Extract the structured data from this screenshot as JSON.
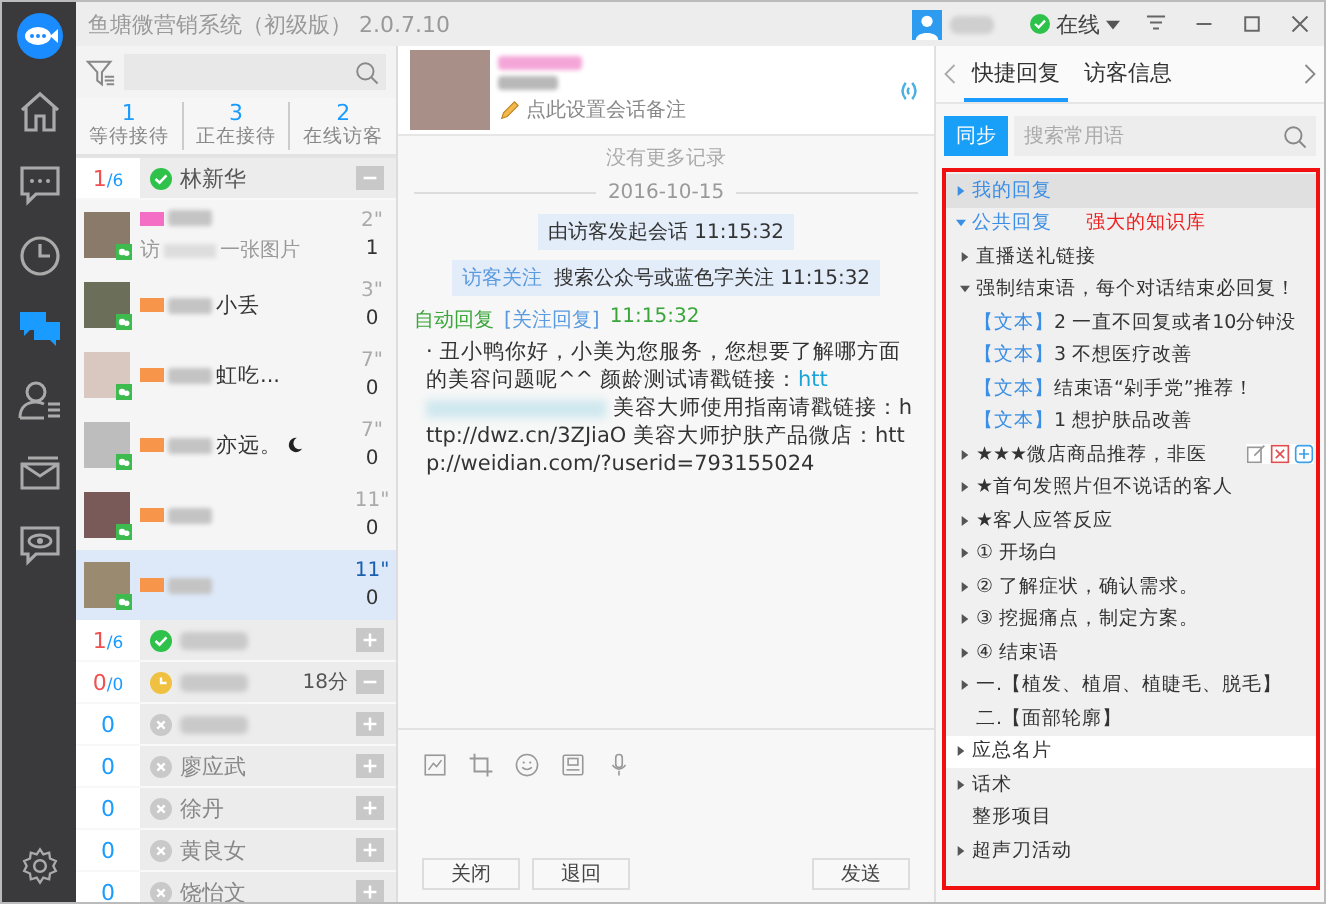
{
  "window": {
    "title": "鱼塘微营销系统（初级版） 2.0.7.10",
    "status": "在线"
  },
  "nav": [
    {
      "kind": "home",
      "selected": false
    },
    {
      "kind": "message",
      "selected": false
    },
    {
      "kind": "history",
      "selected": false
    },
    {
      "kind": "chat",
      "selected": true
    },
    {
      "kind": "contacts",
      "selected": false
    },
    {
      "kind": "mail",
      "selected": false
    },
    {
      "kind": "monitor",
      "selected": false
    }
  ],
  "visitor_stats": [
    {
      "count": "1",
      "label": "等待接待"
    },
    {
      "count": "3",
      "label": "正在接待"
    },
    {
      "count": "2",
      "label": "在线访客"
    }
  ],
  "groups": [
    {
      "count": "1",
      "total": "/6",
      "kind": "online",
      "name": "林新华",
      "expanded": true,
      "conversations": [
        {
          "color": "#f46ec6",
          "preview_head": "访",
          "preview_tail": "一张图片",
          "time": "2\"",
          "unread": "1",
          "selected": false
        },
        {
          "color": "#f7964a",
          "name_tail": "小丢",
          "time": "3\"",
          "unread": "0",
          "selected": false
        },
        {
          "color": "#f7964a",
          "name_tail": "虹吃...",
          "time": "7\"",
          "unread": "0",
          "selected": false
        },
        {
          "color": "#f7964a",
          "name_tail": "亦远。",
          "has_emoji": true,
          "time": "7\"",
          "unread": "0",
          "selected": false
        },
        {
          "color": "#f7964a",
          "time": "11\"",
          "unread": "0",
          "selected": false
        },
        {
          "color": "#f7964a",
          "time": "11\"",
          "unread": "0",
          "selected": true
        }
      ]
    },
    {
      "count": "1",
      "total": "/6",
      "kind": "online",
      "expanded": false
    },
    {
      "count": "0",
      "total": "/0",
      "kind": "away",
      "extra": "18分",
      "expanded": true
    },
    {
      "count": "0",
      "kind": "offline",
      "expanded": false
    },
    {
      "count": "0",
      "kind": "offline",
      "name": "廖应武",
      "expanded": false
    },
    {
      "count": "0",
      "kind": "offline",
      "name": "徐丹",
      "expanded": false
    },
    {
      "count": "0",
      "kind": "offline",
      "name": "黄良女",
      "expanded": false
    },
    {
      "count": "0",
      "kind": "offline",
      "name": "饶怡文",
      "expanded": false
    }
  ],
  "chat": {
    "remark_hint": "点此设置会话备注",
    "messages": [
      {
        "kind": "notice",
        "text": "没有更多记录"
      },
      {
        "kind": "date",
        "text": "2016-10-15"
      },
      {
        "kind": "system",
        "text": "由访客发起会话 11:15:32"
      },
      {
        "kind": "system",
        "label": "访客关注",
        "text": "搜索公众号或蓝色字关注  11:15:32"
      },
      {
        "kind": "reply",
        "sender": "自动回复",
        "tag": "[关注回复]",
        "time": "11:15:32",
        "text": "· 丑小鸭你好，小美为您服务，您想要了解哪方面的美容问题呢^^ 颜龄测试请戳链接：",
        "link": "htt",
        "text_after": "美容大师使用指南请戳链接：http://dwz.cn/3ZJiaO 美容大师护肤产品微店：http://weidian.com/?userid=793155024"
      }
    ],
    "tools": [
      {
        "kind": "image"
      },
      {
        "kind": "crop"
      },
      {
        "kind": "emoji"
      },
      {
        "kind": "card"
      },
      {
        "kind": "voice"
      }
    ],
    "buttons": [
      "关闭",
      "退回"
    ],
    "send": "发送"
  },
  "panel": {
    "tabs": [
      {
        "label": "快捷回复",
        "selected": true
      },
      {
        "label": "访客信息",
        "selected": false
      }
    ],
    "sync": "同步",
    "search": {
      "placeholder": "搜索常用语"
    },
    "annotation": "强大的知识库",
    "tree": [
      {
        "kind": "section",
        "label": "我的回复",
        "expanded": false,
        "selected": false
      },
      {
        "kind": "section",
        "label": "公共回复",
        "expanded": true,
        "selected": false,
        "children": [
          {
            "kind": "folder",
            "label": "直播送礼链接",
            "expanded": false,
            "selected": false
          },
          {
            "kind": "folder",
            "label": "强制结束语，每个对话结束必回复！",
            "expanded": true,
            "selected": false,
            "children": [
              {
                "kind": "text",
                "tag": "【文本】",
                "label": "2 一直不回复或者10分钟没",
                "selected": false
              },
              {
                "kind": "text",
                "tag": "【文本】",
                "label": "3 不想医疗改善",
                "selected": false
              },
              {
                "kind": "text",
                "tag": "【文本】",
                "label": "结束语“剁手党”推荐！",
                "selected": false
              },
              {
                "kind": "text",
                "tag": "【文本】",
                "label": "1 想护肤品改善",
                "selected": false
              }
            ]
          },
          {
            "kind": "folder",
            "label": "★★★微店商品推荐，非医",
            "expanded": false,
            "selected": false,
            "actions": true
          },
          {
            "kind": "folder",
            "label": "★首句发照片但不说话的客人",
            "expanded": false,
            "selected": false
          },
          {
            "kind": "folder",
            "label": "★客人应答反应",
            "expanded": false,
            "selected": false
          },
          {
            "kind": "folder",
            "label": "① 开场白",
            "expanded": false,
            "selected": false
          },
          {
            "kind": "folder",
            "label": "② 了解症状，确认需求。",
            "expanded": false,
            "selected": false
          },
          {
            "kind": "folder",
            "label": "③ 挖掘痛点，制定方案。",
            "expanded": false,
            "selected": false
          },
          {
            "kind": "folder",
            "label": "④ 结束语",
            "expanded": false,
            "selected": false
          },
          {
            "kind": "folder",
            "label": "一.【植发、植眉、植睫毛、脱毛】",
            "expanded": false,
            "selected": false
          },
          {
            "kind": "leaf",
            "label": "二.【面部轮廓】",
            "selected": false
          }
        ]
      },
      {
        "kind": "folder",
        "label": "应总名片",
        "expanded": false,
        "selected": true
      },
      {
        "kind": "folder",
        "label": "话术",
        "expanded": false,
        "selected": false
      },
      {
        "kind": "leaf",
        "label": "整形项目",
        "selected": false
      },
      {
        "kind": "folder",
        "label": "超声刀活动",
        "expanded": false,
        "selected": false
      }
    ]
  }
}
